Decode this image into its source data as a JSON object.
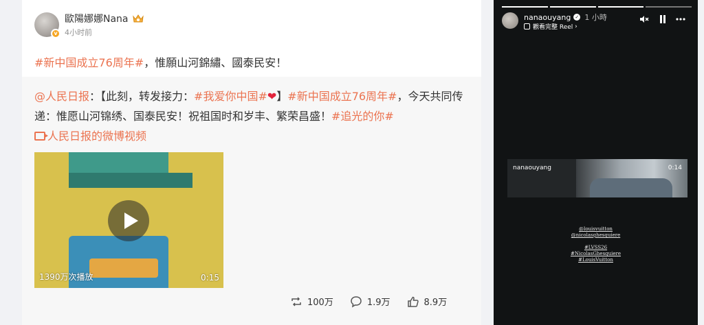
{
  "weibo": {
    "username": "歐陽娜娜Nana",
    "timestamp": "4小时前",
    "post_text": {
      "tag": "#新中国成立76周年#",
      "rest": "，惟願山河錦繡、國泰民安！"
    },
    "repost": {
      "mention": "@人民日报",
      "p1": "：【此刻，转发接力：",
      "tag1": "#我爱你中国#",
      "heart": "❤",
      "p2": "】",
      "tag2": "#新中国成立76周年#",
      "p3": "，今天共同传递：惟愿山河锦绣、国泰民安！祝祖国时和岁丰、繁荣昌盛！",
      "tag3": "#追光的你#",
      "video_link": "人民日报的微博视频"
    },
    "video": {
      "views": "1390万次播放",
      "duration": "0:15"
    },
    "actions": {
      "reposts": "100万",
      "comments": "1.9万",
      "likes": "8.9万"
    }
  },
  "story": {
    "username": "nanaouyang",
    "time": "1 小時",
    "reel_label": "觀看完整 Reel",
    "video_username": "nanaouyang",
    "video_time": "0:14",
    "captions": [
      "@louisvuitton",
      "@nicolasghesquiere",
      "#LVSS26",
      "#NicolasGhesquiere",
      "#LouisVuitton"
    ]
  }
}
